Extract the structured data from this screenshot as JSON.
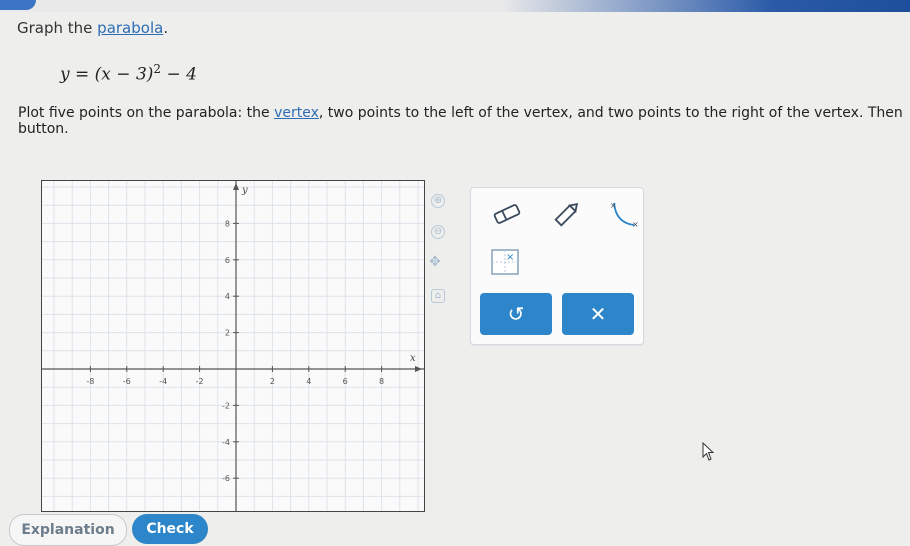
{
  "prompt": {
    "prefix": "Graph the ",
    "link": "parabola",
    "suffix": "."
  },
  "equation": {
    "lhs": "y",
    "base": "(x − 3)",
    "exponent": "2",
    "tail": "− 4"
  },
  "instructions": {
    "part1": "Plot five points on the parabola: the ",
    "link": "vertex",
    "part2": ", two points to the left of the vertex, and two points to the right of the vertex. Then",
    "part3": "button."
  },
  "graph": {
    "x_axis_label": "x",
    "y_axis_label": "y",
    "x_tick_labels": [
      "-8",
      "-6",
      "-4",
      "-2",
      "2",
      "4",
      "6",
      "8"
    ],
    "y_tick_labels": [
      "8",
      "6",
      "4",
      "2",
      "-2",
      "-4",
      "-6"
    ]
  },
  "side_tools": {
    "zoom_in": "⊕",
    "zoom_out": "⊖",
    "move": "✥",
    "reset": "⌂"
  },
  "tools": {
    "undo_label": "↺",
    "clear_label": "✕"
  },
  "bottom": {
    "explanation_label": "Explanation",
    "check_label": "Check"
  },
  "colors": {
    "accent": "#2c86c9",
    "link": "#2e6db4"
  }
}
